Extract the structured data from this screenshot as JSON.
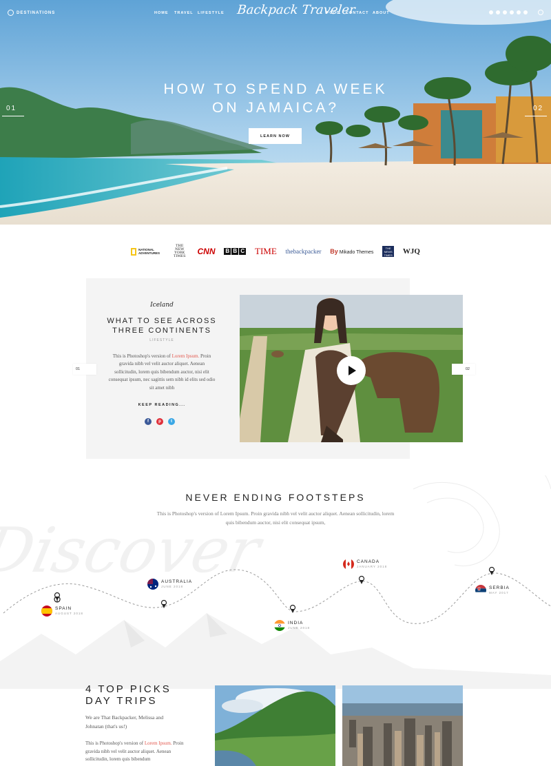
{
  "header": {
    "destinations": "DESTINATIONS",
    "nav_left": [
      "HOME",
      "TRAVEL",
      "LIFESTYLE"
    ],
    "logo": "Backpack Traveler",
    "nav_right": [
      "FOOD",
      "CONTACT",
      "ABOUT"
    ],
    "socials": [
      "instagram-icon",
      "twitter-icon",
      "facebook-icon",
      "pinterest-icon",
      "rss-icon",
      "youtube-icon"
    ]
  },
  "hero": {
    "title_line1": "HOW TO SPEND A WEEK",
    "title_line2": "ON JAMAICA?",
    "button": "LEARN NOW",
    "slide_left": "01",
    "slide_right": "02"
  },
  "partners": {
    "natgeo": "NATIONAL ADVENTURES",
    "nyt": "THE NEW YORK TIMES",
    "cnn": "CNN",
    "bbc": [
      "B",
      "B",
      "C"
    ],
    "time": "TIME",
    "backpacker": "thebackpacker",
    "mikado_by": "By",
    "mikado": "Mikado Themes",
    "news": "THE NEWS TIMES",
    "wjq": "WJQ"
  },
  "feature": {
    "script": "Iceland",
    "title_line1": "WHAT TO SEE ACROSS",
    "title_line2": "THREE CONTINENTS",
    "category": "LIFESTYLE",
    "text_before": "This is Photoshop's version  of ",
    "text_link": "Lorem Ipsum.",
    "text_after": " Proin gravida nibh vel velit auctor aliquet. Aenean sollicitudin, lorem quis bibendum auctor, nisi elit consequat ipsum, nec sagittis sem nibh id elits sed odio sit amet nibh",
    "read_more": "KEEP READING...",
    "slide_left": "01",
    "slide_right": "02"
  },
  "footsteps": {
    "title": "NEVER ENDING FOOTSTEPS",
    "text": "This is Photoshop's version  of Lorem Ipsum. Proin gravida nibh vel velit auctor aliquet. Aenean sollicitudin, lorem quis bibendum auctor, nisi elit consequat ipsum,",
    "background_word": "Discover",
    "locations": [
      {
        "name": "SPAIN",
        "date": "AUGUST 2018"
      },
      {
        "name": "AUSTRALIA",
        "date": "JUNE 2018"
      },
      {
        "name": "INDIA",
        "date": "JUNE 2018"
      },
      {
        "name": "CANADA",
        "date": "JANUARY 2018"
      },
      {
        "name": "SERBIA",
        "date": "MAY 2017"
      }
    ]
  },
  "picks": {
    "title_line1": "4 TOP PICKS",
    "title_line2": "DAY TRIPS",
    "subtitle": "We are That Backpacker, Melissa and Johnatan (that's us!)",
    "text_before": "This is Photoshop's version  of ",
    "text_link": "Lorem Ipsum.",
    "text_after": " Proin gravida nibh vel velit auctor aliquet. Aenean sollicitudin, lorem quis bibendum"
  },
  "colors": {
    "accent": "#e2564c",
    "panel": "#f4f4f4"
  }
}
